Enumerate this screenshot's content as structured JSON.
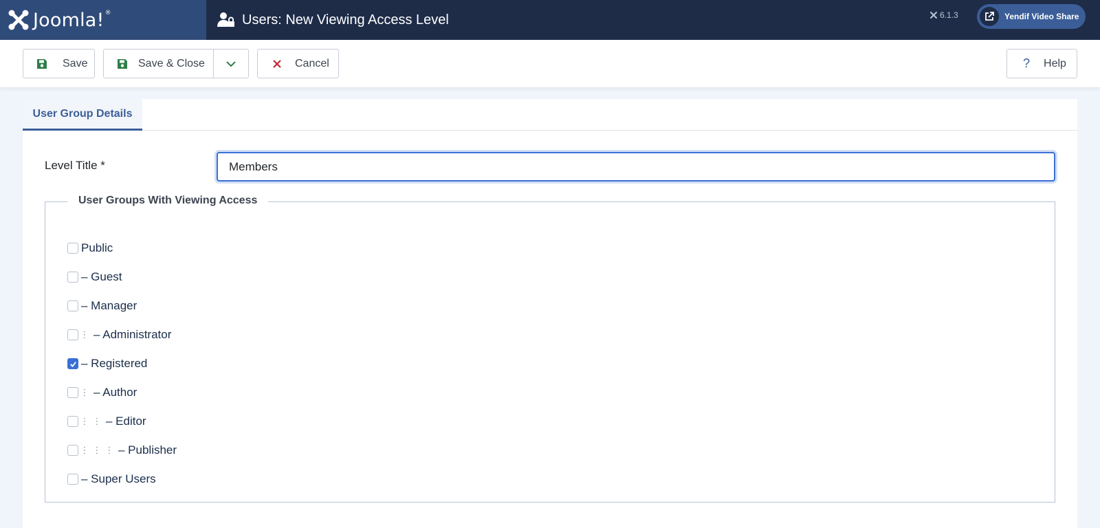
{
  "header": {
    "logo_text": "Joomla!",
    "logo_reg": "®",
    "page_title": "Users: New Viewing Access Level",
    "version": "6.1.3",
    "site_button_label": "Yendif Video Share"
  },
  "toolbar": {
    "save_label": "Save",
    "save_close_label": "Save & Close",
    "cancel_label": "Cancel",
    "help_label": "Help"
  },
  "tabs": [
    {
      "label": "User Group Details",
      "active": true
    }
  ],
  "form": {
    "level_title_label": "Level Title *",
    "level_title_value": "Members",
    "fieldset_legend": "User Groups With Viewing Access",
    "groups": [
      {
        "label": "Public",
        "depth": 0,
        "checked": false
      },
      {
        "label": "– Guest",
        "depth": 0,
        "checked": false
      },
      {
        "label": "– Manager",
        "depth": 0,
        "checked": false
      },
      {
        "label": "– Administrator",
        "depth": 1,
        "checked": false
      },
      {
        "label": "– Registered",
        "depth": 0,
        "checked": true
      },
      {
        "label": "– Author",
        "depth": 1,
        "checked": false
      },
      {
        "label": "– Editor",
        "depth": 2,
        "checked": false
      },
      {
        "label": "– Publisher",
        "depth": 3,
        "checked": false
      },
      {
        "label": "– Super Users",
        "depth": 0,
        "checked": false
      }
    ],
    "indent_glyph": "⋮"
  },
  "colors": {
    "header_bg": "#1e2c48",
    "logo_bg": "#2f4b79",
    "accent": "#3b5e98",
    "save_icon": "#2e7d4a",
    "cancel_icon": "#c0282d",
    "focus": "#3b6fd6"
  },
  "icons": {
    "logo": "joomla-logo-icon",
    "title": "user-lock-icon",
    "save": "floppy-disk-icon",
    "dropdown": "chevron-down-icon",
    "cancel": "close-icon",
    "help": "question-icon",
    "external": "external-link-icon"
  }
}
